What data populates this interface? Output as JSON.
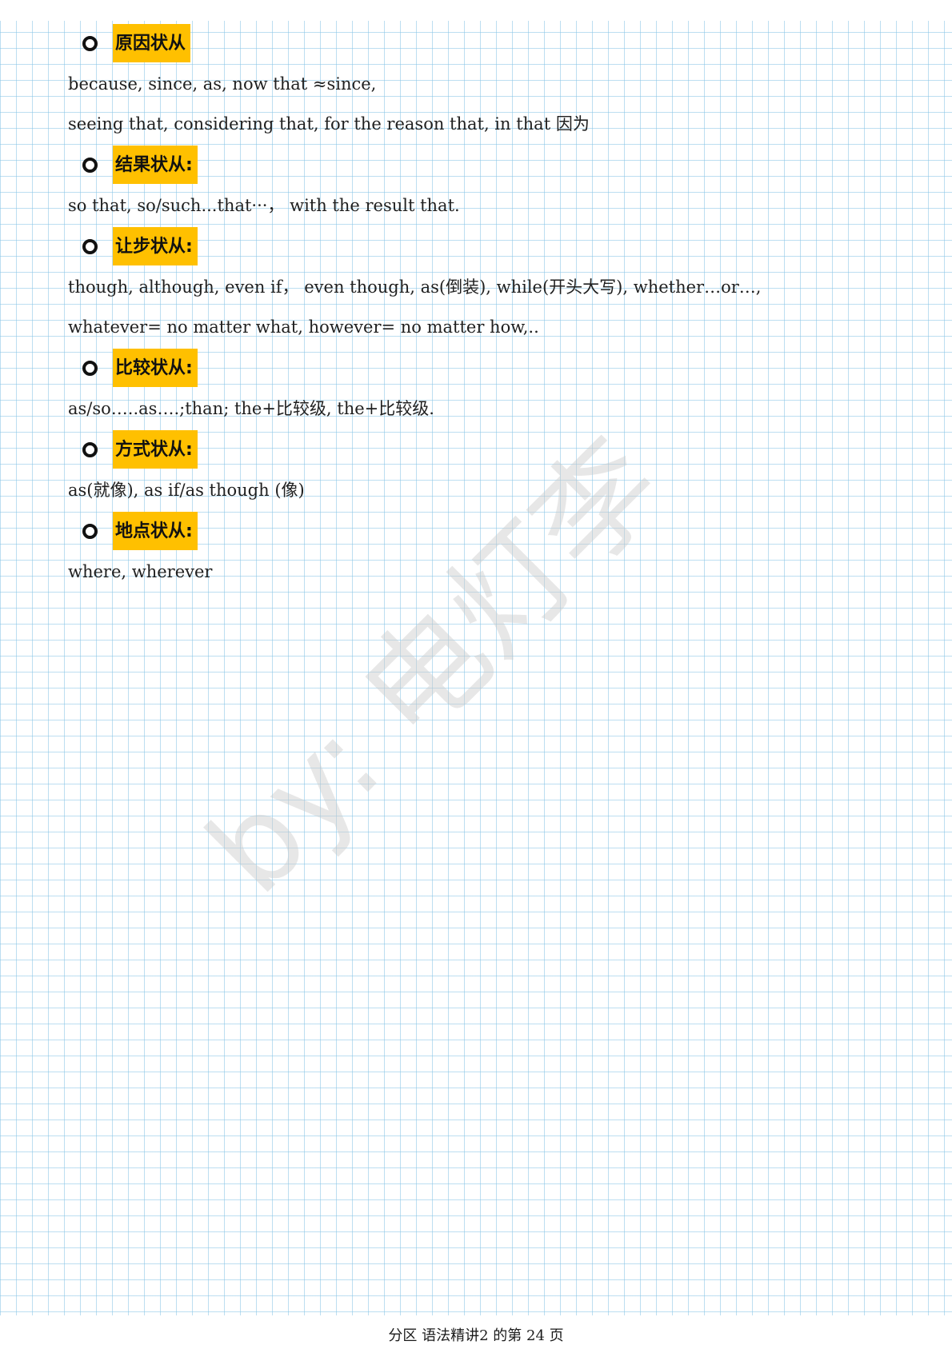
{
  "sections": [
    {
      "title": "原因状从",
      "lines": [
        "because, since, as, now that ≈since,",
        "seeing that, considering that, for the reason that, in that 因为"
      ]
    },
    {
      "title": "结果状从:",
      "lines": [
        "so that, so/such...that···，  with the result that."
      ]
    },
    {
      "title": "让步状从:",
      "lines": [
        "though, although, even if， even though, as(倒装), while(开头大写), whether…or…,",
        "whatever= no matter what, however= no matter how,.."
      ]
    },
    {
      "title": "比较状从:",
      "lines": [
        "as/so…..as….;than; the+比较级, the+比较级."
      ]
    },
    {
      "title": "方式状从:",
      "lines": [
        "as(就像), as if/as though (像)"
      ]
    },
    {
      "title": "地点状从:",
      "lines": [
        "where, wherever"
      ]
    }
  ],
  "watermark": {
    "text": "by: 电灯李"
  },
  "footer": {
    "text": "分区 语法精讲2 的第 24 页"
  }
}
